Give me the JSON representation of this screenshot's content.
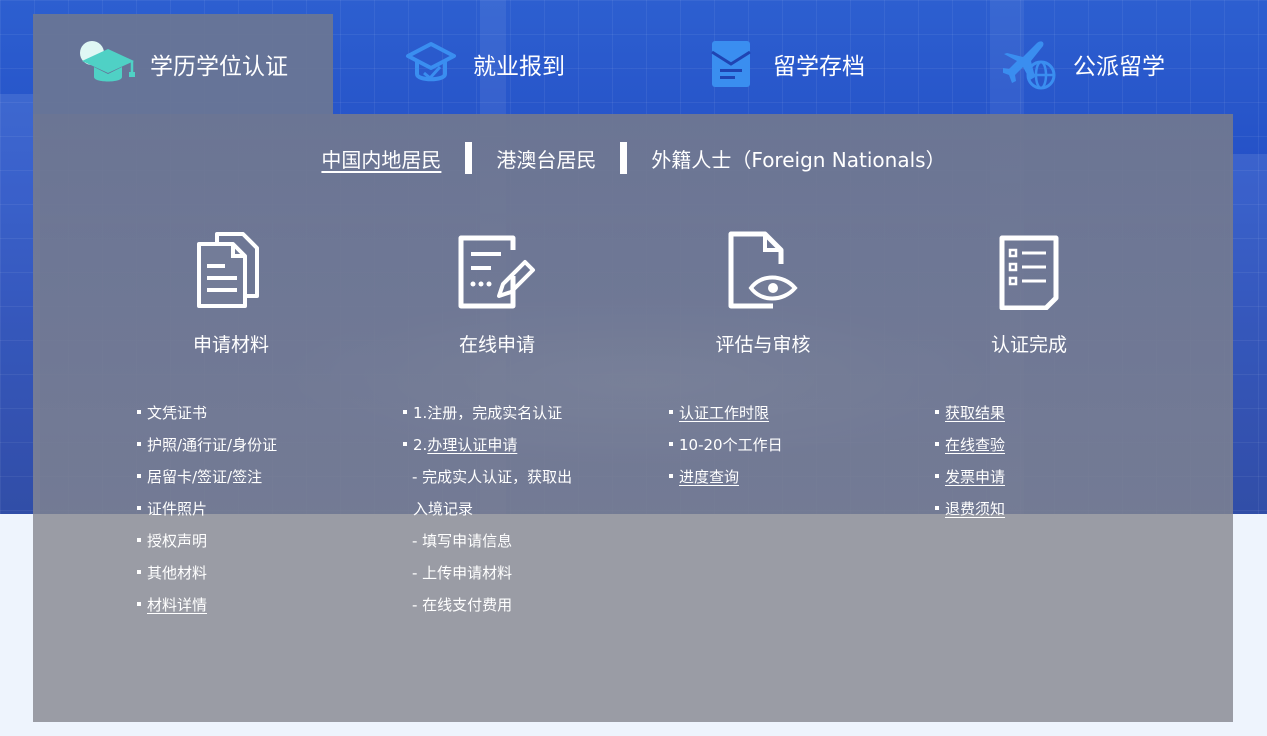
{
  "tabs": [
    {
      "label": "学历学位认证",
      "icon": "graduation-cap-icon",
      "active": true
    },
    {
      "label": "就业报到",
      "icon": "cap-badge-icon",
      "active": false
    },
    {
      "label": "留学存档",
      "icon": "archive-envelope-icon",
      "active": false
    },
    {
      "label": "公派留学",
      "icon": "airplane-globe-icon",
      "active": false
    }
  ],
  "residency": {
    "mainland": "中国内地居民",
    "hmt": "港澳台居民",
    "foreign": "外籍人士（Foreign Nationals）"
  },
  "steps": [
    {
      "title": "申请材料",
      "icon": "documents-icon"
    },
    {
      "title": "在线申请",
      "icon": "edit-form-icon"
    },
    {
      "title": "评估与审核",
      "icon": "file-eye-icon"
    },
    {
      "title": "认证完成",
      "icon": "checklist-icon"
    }
  ],
  "materials": [
    "文凭证书",
    "护照/通行证/身份证",
    "居留卡/签证/签注",
    "证件照片",
    "授权声明",
    "其他材料"
  ],
  "materials_link": "材料详情",
  "online": {
    "step1": "1.注册，完成实名认证",
    "step2_prefix": "2.",
    "step2_link": "办理认证申请",
    "sub1a": "- 完成实人认证，获取出",
    "sub1b": "入境记录",
    "sub2": "- 填写申请信息",
    "sub3": "- 上传申请材料",
    "sub4": "- 在线支付费用"
  },
  "review": {
    "link1": "认证工作时限",
    "text": "10-20个工作日",
    "link2": "进度查询"
  },
  "complete": [
    "获取结果",
    "在线查验",
    "发票申请",
    "退费须知"
  ],
  "colors": {
    "accent_blue": "#3a8ef0",
    "teal": "#4fd1c5",
    "panel": "#8c8d96"
  }
}
